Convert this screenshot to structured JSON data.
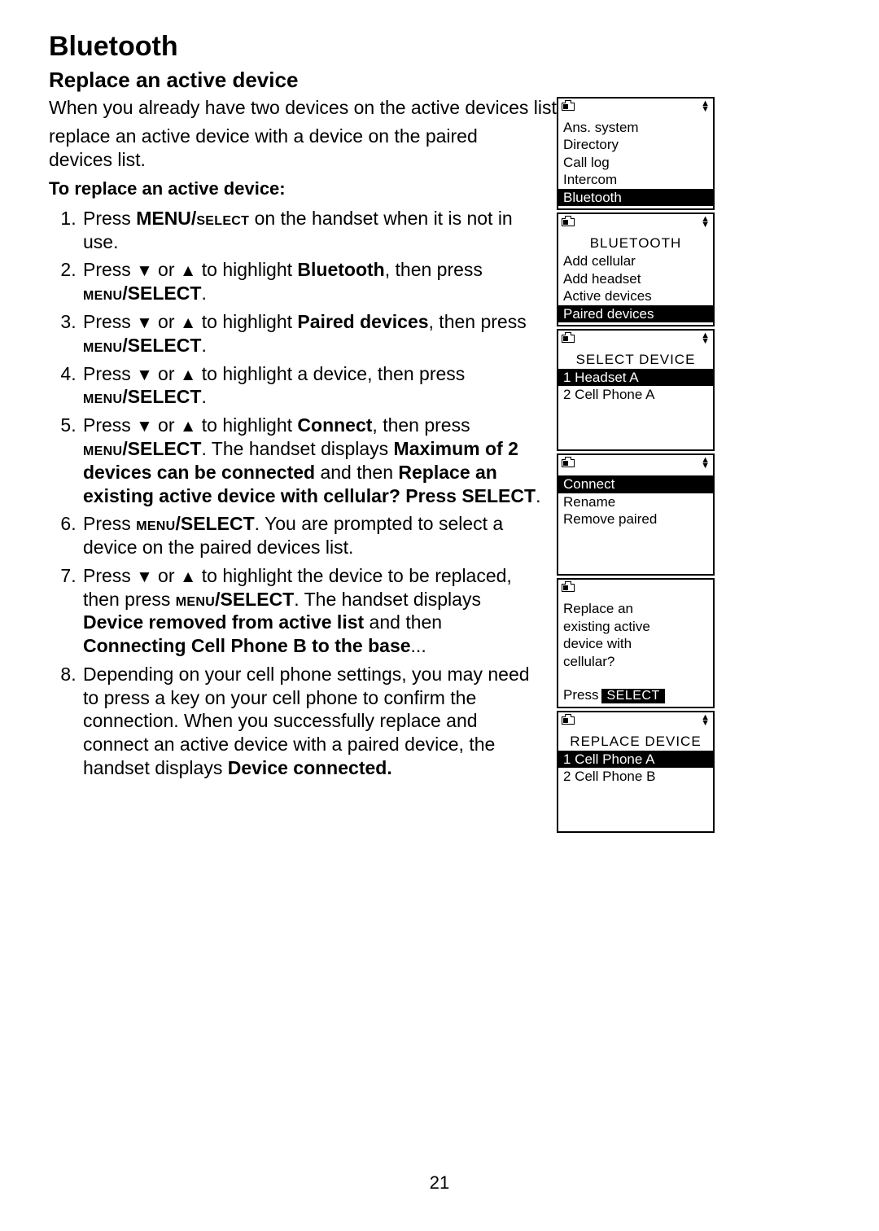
{
  "page": {
    "number": "21",
    "h1": "Bluetooth",
    "h2": "Replace an active device",
    "intro_full": "When you already have two devices on the active devices list, you can replace an active device with a device on the paired devices list.",
    "intro_wide": "When you already have two devices on the active devices list, you can",
    "intro_narrow": "replace an active device with a device on the paired devices list.",
    "subhead": "To replace an active device:",
    "steps": {
      "s1a": "Press ",
      "s1b": "MENU/",
      "s1c": "select",
      "s1d": " on the handset when it is not in use.",
      "s2a": "Press ",
      "s2b": " or ",
      "s2c": " to highlight ",
      "s2d": "Bluetooth",
      "s2e": ", then press ",
      "s2f": "menu",
      "s2g": "/SELECT",
      "s2h": ".",
      "s3a": "Press ",
      "s3b": " or ",
      "s3c": " to highlight ",
      "s3d": "Paired devices",
      "s3e": ", then press ",
      "s3f": "menu",
      "s3g": "/SELECT",
      "s3h": ".",
      "s4a": "Press ",
      "s4b": " or ",
      "s4c": " to highlight a device, then press ",
      "s4f": "menu",
      "s4g": "/SELECT",
      "s4h": ".",
      "s5a": "Press ",
      "s5b": " or ",
      "s5c": " to highlight ",
      "s5d": "Connect",
      "s5e": ", then press ",
      "s5f": "menu",
      "s5g": "/SELECT",
      "s5h": ". The handset displays ",
      "s5i": "Maximum of 2 devices can be connected",
      "s5j": " and then ",
      "s5k": "Replace an existing active device with cellular? Press SELECT",
      "s5l": ".",
      "s6a": "Press ",
      "s6f": "menu",
      "s6g": "/SELECT",
      "s6h": ". You are prompted to select a device on the paired devices list.",
      "s7a": "Press ",
      "s7b": " or ",
      "s7c": " to highlight the device to be replaced, then press ",
      "s7f": "menu",
      "s7g": "/SELECT",
      "s7h": ". The handset displays ",
      "s7i": "Device removed from active list",
      "s7j": " and then ",
      "s7k": "Connecting Cell Phone B to the base",
      "s7l": "...",
      "s8": "Depending on your cell phone settings, you may need to press a key on your cell phone to confirm the connection. When you successfully replace and connect an active device with a paired device, the handset displays ",
      "s8b": "Device connected."
    },
    "triangles": {
      "down": "▼",
      "up": "▲"
    }
  },
  "screens": {
    "main": {
      "items": [
        "Ans. system",
        "Directory",
        "Call log",
        "Intercom",
        "Bluetooth"
      ],
      "highlighted": 4
    },
    "bt": {
      "title": "BLUETOOTH",
      "items": [
        "Add cellular",
        "Add headset",
        "Active devices",
        "Paired devices"
      ],
      "highlighted": 3
    },
    "seldev": {
      "title": "SELECT DEVICE",
      "items": [
        "1 Headset A",
        "2 Cell Phone A"
      ],
      "highlighted": 0
    },
    "conn": {
      "items": [
        "Connect",
        "Rename",
        "Remove paired"
      ],
      "highlighted": 0
    },
    "msg": {
      "lines": [
        "Replace an",
        "existing active",
        "device with",
        "cellular?"
      ],
      "press": "Press",
      "select": "SELECT"
    },
    "rep": {
      "title": "REPLACE DEVICE",
      "items": [
        "1 Cell Phone A",
        "2 Cell Phone B"
      ],
      "highlighted": 0
    }
  }
}
